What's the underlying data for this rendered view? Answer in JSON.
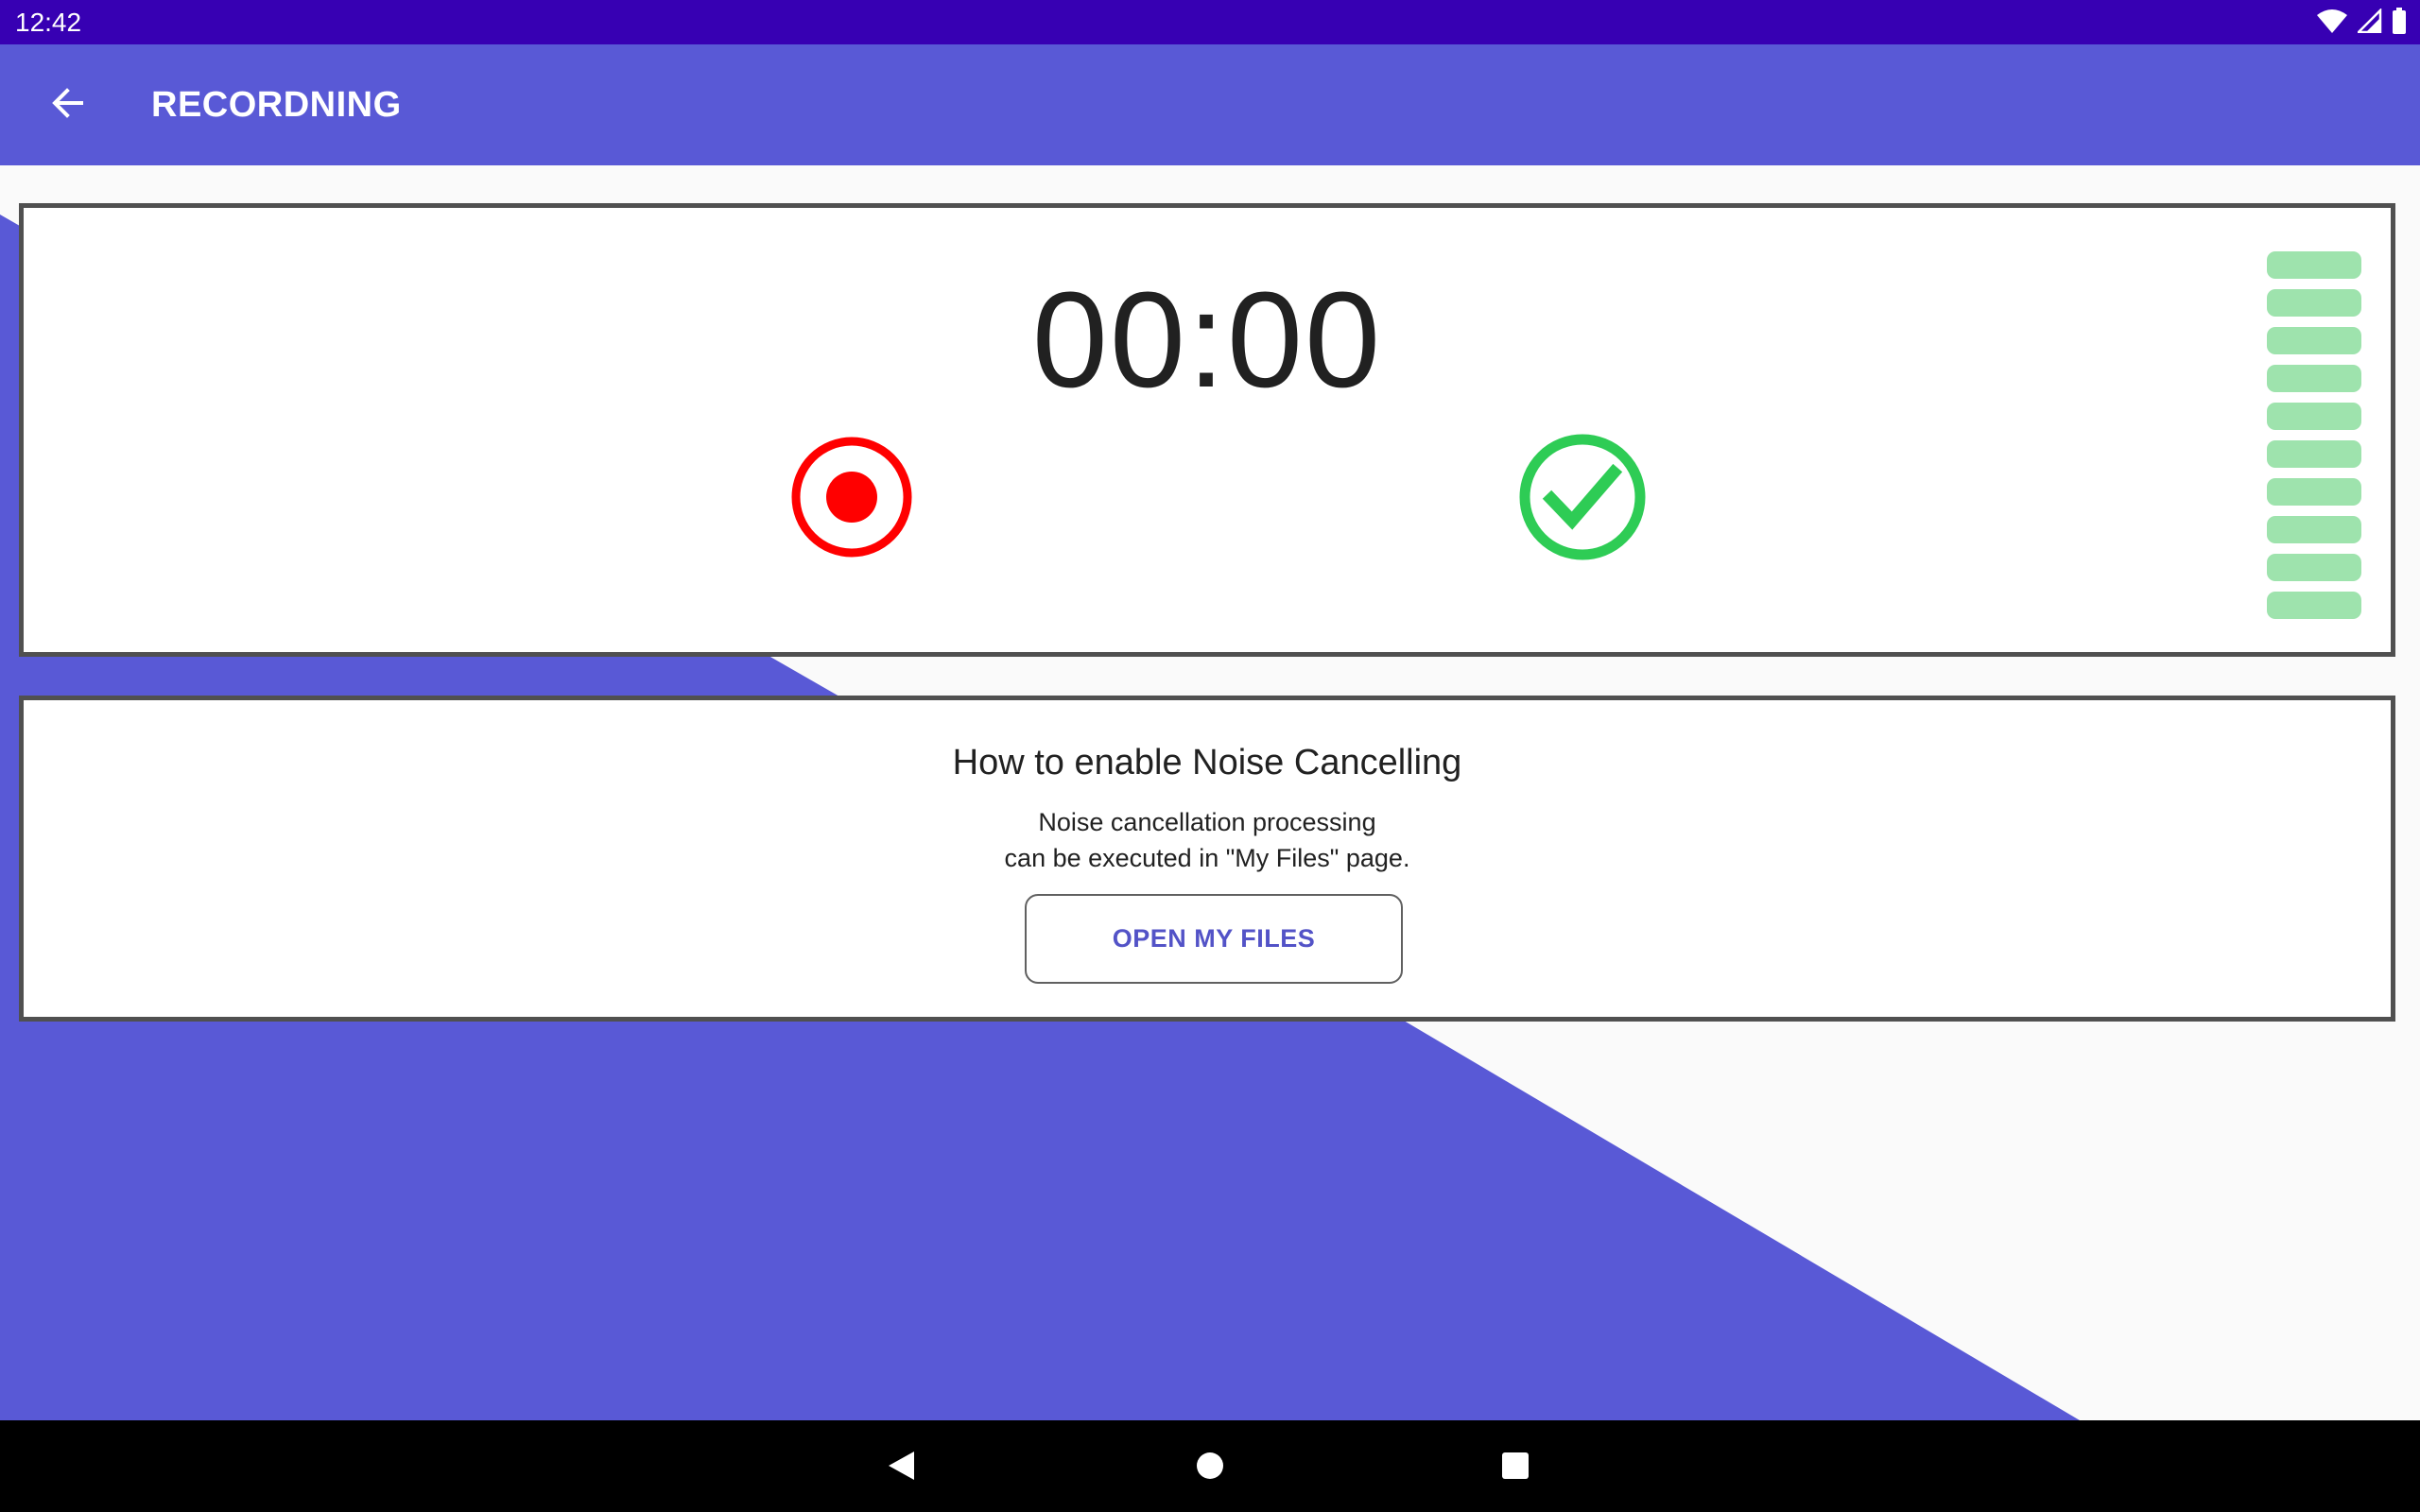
{
  "status_bar": {
    "time": "12:42",
    "icons": [
      "wifi-icon",
      "cell-signal-icon",
      "battery-icon"
    ]
  },
  "app_bar": {
    "title": "RECORDNING",
    "back_icon": "arrow-left-icon"
  },
  "recorder": {
    "timer": "00:00",
    "record_icon": "record-icon",
    "done_icon": "check-circle-icon",
    "level_segments": 10,
    "colors": {
      "record": "#ff0000",
      "done": "#2ecc55",
      "level": "#9ee3ad"
    }
  },
  "noise_info": {
    "title": "How to enable Noise Cancelling",
    "body_line1": "Noise cancellation processing",
    "body_line2": "can be executed in \"My Files\" page.",
    "button_label": "OPEN MY FILES"
  },
  "nav_bar": {
    "icons": [
      "nav-back-icon",
      "nav-home-icon",
      "nav-recents-icon"
    ]
  },
  "colors": {
    "status_bar": "#3700b3",
    "app_bar": "#5959d6",
    "background": "#fafafa",
    "accent_text": "#5353c7"
  }
}
